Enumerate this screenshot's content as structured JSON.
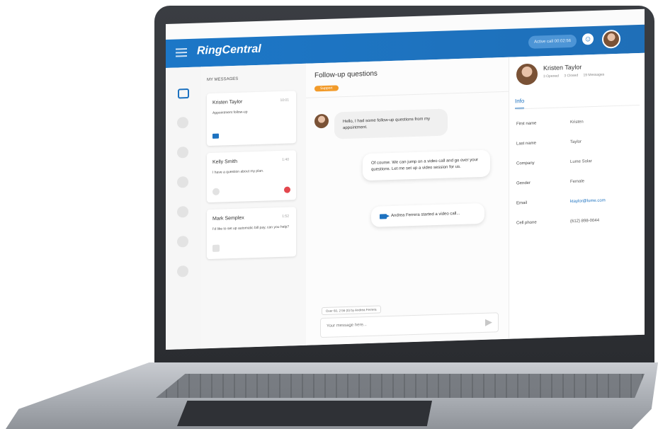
{
  "app": {
    "brand": "RingCentral",
    "active_call": "Active call 00:02:56"
  },
  "messages_panel": {
    "title": "MY MESSAGES",
    "items": [
      {
        "name": "Kristen Taylor",
        "time": "10:01",
        "preview": "Appointment follow-up"
      },
      {
        "name": "Kelly Smith",
        "time": "1:40",
        "preview": "I have a question about my plan."
      },
      {
        "name": "Mark Semplex",
        "time": "1:52",
        "preview": "I'd like to set up automatic bill pay, can you help?"
      }
    ]
  },
  "conversation": {
    "title": "Follow-up questions",
    "tag": "Support",
    "messages": [
      {
        "type": "incoming",
        "text": "Hello, I had some follow-up questions from my appointment."
      },
      {
        "type": "outgoing",
        "text": "Of course. We can jump on a video call and go over your questions. Let me set up a video session for us."
      },
      {
        "type": "system",
        "text": "Andrea Ferrera started a video call..."
      }
    ],
    "filter": "Over 60, 2:56 (0) by Andrea Ferrera",
    "composer_placeholder": "Your message here..."
  },
  "contact": {
    "name": "Kristen Taylor",
    "stats": [
      "3 Opened",
      "3 Closed",
      "19 Messages"
    ],
    "tab": "Info",
    "fields": [
      {
        "label": "First name",
        "value": "Kristen"
      },
      {
        "label": "Last name",
        "value": "Taylor"
      },
      {
        "label": "Company",
        "value": "Lume Solar"
      },
      {
        "label": "Gender",
        "value": "Female"
      },
      {
        "label": "Email",
        "value": "ktaylor@lume.com"
      },
      {
        "label": "Cell phone",
        "value": "(612) 898-0044"
      }
    ]
  },
  "colors": {
    "brand_blue": "#1d72c0",
    "tag_orange": "#f29b2a",
    "alert_red": "#e3474e"
  },
  "icons": [
    "menu-icon",
    "chat-icon",
    "smile-icon",
    "mail-icon",
    "video-icon",
    "send-icon"
  ]
}
